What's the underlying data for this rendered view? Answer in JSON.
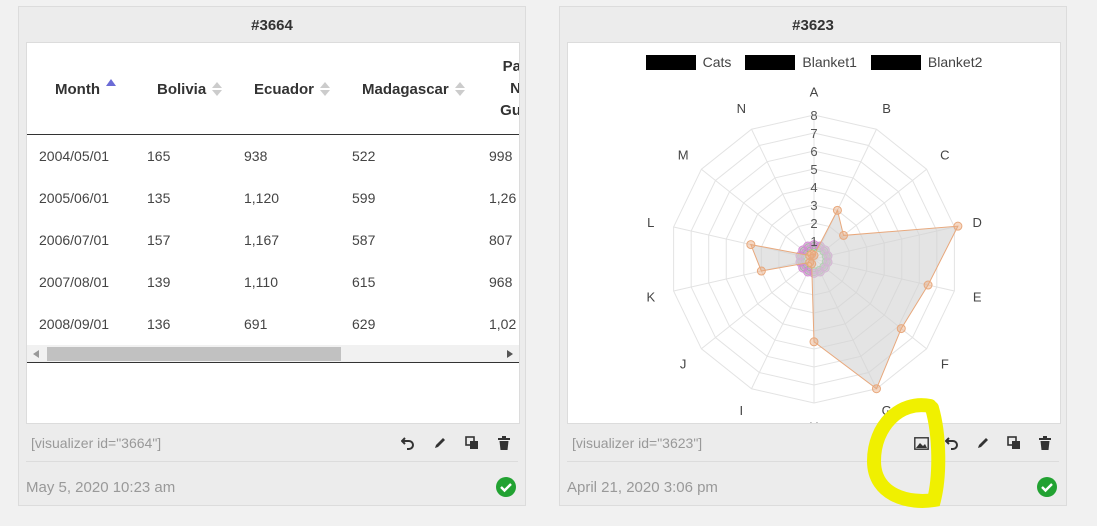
{
  "cards": [
    {
      "title": "#3664",
      "shortcode": "[visualizer id=\"3664\"]",
      "date": "May 5, 2020 10:23 am",
      "table": {
        "headers": [
          "Month",
          "Bolivia",
          "Ecuador",
          "Madagascar",
          "Pa N Gu"
        ],
        "header_lines": [
          [
            "Month"
          ],
          [
            "Bolivia"
          ],
          [
            "Ecuador"
          ],
          [
            "Madagascar"
          ],
          [
            "Pa",
            "N",
            "Gu"
          ]
        ],
        "rows": [
          [
            "2004/05/01",
            "165",
            "938",
            "522",
            "998"
          ],
          [
            "2005/06/01",
            "135",
            "1,120",
            "599",
            "1,26"
          ],
          [
            "2006/07/01",
            "157",
            "1,167",
            "587",
            "807"
          ],
          [
            "2007/08/01",
            "139",
            "1,110",
            "615",
            "968"
          ],
          [
            "2008/09/01",
            "136",
            "691",
            "629",
            "1,02"
          ]
        ]
      }
    },
    {
      "title": "#3623",
      "shortcode": "[visualizer id=\"3623\"]",
      "date": "April 21, 2020 3:06 pm"
    }
  ],
  "chart_data": {
    "type": "radar",
    "axes": [
      "A",
      "B",
      "C",
      "D",
      "E",
      "F",
      "G",
      "H",
      "I",
      "J",
      "K",
      "L",
      "M",
      "N"
    ],
    "r_ticks": [
      "1",
      "2",
      "3",
      "4",
      "5",
      "6",
      "7",
      "8"
    ],
    "rlim": [
      0,
      8
    ],
    "legend_position": "top",
    "series": [
      {
        "name": "Cats",
        "color": "#e8a87c",
        "fill": "rgba(210,210,210,0.6)",
        "values": [
          0.2,
          3,
          2.1,
          8.2,
          6.5,
          6.2,
          8,
          4.6,
          0.3,
          0.3,
          3,
          3.6,
          0.3,
          0.3
        ]
      },
      {
        "name": "Blanket1",
        "color": "#d58ad5",
        "values": [
          0.8,
          0.8,
          0.8,
          0.8,
          0.8,
          0.8,
          0.8,
          0.8,
          0.8,
          0.8,
          0.8,
          0.8,
          0.8,
          0.8
        ]
      },
      {
        "name": "Blanket2",
        "color": "#88c888",
        "values": [
          0.7,
          0.7,
          0.7,
          0.7,
          0.7,
          0.7,
          0.7,
          0.7,
          0.7,
          0.7,
          0.7,
          0.7,
          0.7,
          0.7
        ]
      }
    ]
  },
  "colors": {
    "accent": "#6b6bd6",
    "check": "#22a232",
    "highlight": "#f0f000"
  },
  "icons": [
    "undo-icon",
    "pencil-icon",
    "copy-icon",
    "trash-icon",
    "image-icon",
    "check-circle-icon"
  ]
}
